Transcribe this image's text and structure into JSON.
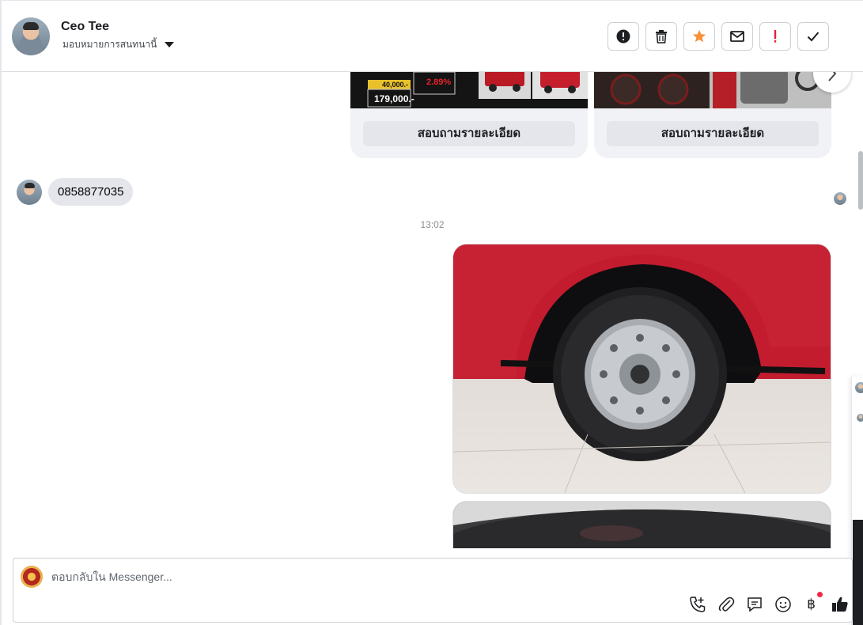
{
  "header": {
    "contact_name": "Ceo Tee",
    "assign_label": "มอบหมายการสนทนานี้",
    "actions": [
      {
        "name": "report-spam-icon",
        "label": "!",
        "color": "#1c1e21"
      },
      {
        "name": "trash-icon",
        "label": "🗑",
        "color": "#1c1e21"
      },
      {
        "name": "star-icon",
        "label": "★",
        "color": "#f7923b"
      },
      {
        "name": "envelope-icon",
        "label": "✉",
        "color": "#1c1e21"
      },
      {
        "name": "follow-up-icon",
        "label": "!",
        "color": "#e41e3f"
      },
      {
        "name": "done-check-icon",
        "label": "✓",
        "color": "#1c1e21"
      }
    ]
  },
  "cards": {
    "left_ad": {
      "price1": "40,000.-",
      "price2": "179,000.-",
      "rate": "2.89%"
    },
    "buttons": [
      "สอบถามรายละเอียด",
      "สอบถามรายละเอียด"
    ]
  },
  "messages": {
    "incoming_text": "0858877035",
    "timestamp": "13:02"
  },
  "composer": {
    "placeholder": "ตอบกลับใน Messenger...",
    "tools": [
      "phone-plus-icon",
      "paperclip-icon",
      "chat-bubble-icon",
      "emoji-icon",
      "baht-icon",
      "thumbs-up-icon"
    ],
    "baht_symbol": "฿"
  }
}
